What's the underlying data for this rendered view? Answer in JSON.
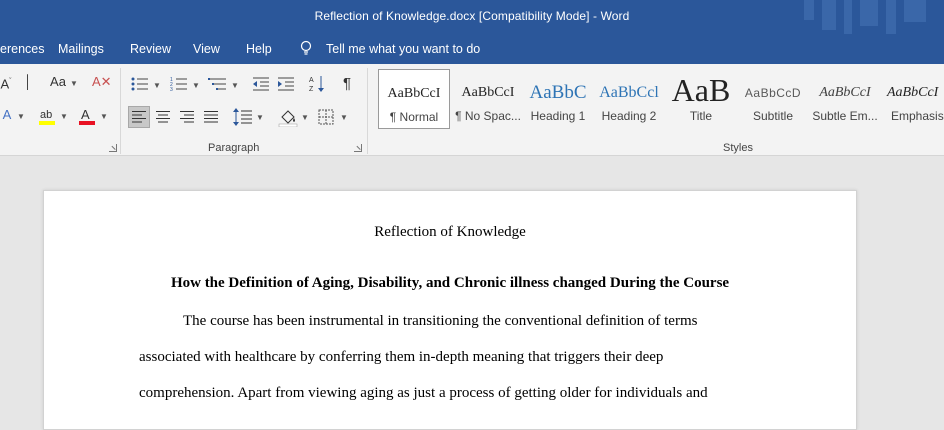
{
  "window": {
    "title": "Reflection of Knowledge.docx [Compatibility Mode]  -  Word"
  },
  "menu": {
    "items": [
      "erences",
      "Mailings",
      "Review",
      "View",
      "Help"
    ],
    "tell_me": "Tell me what you want to do"
  },
  "ribbon": {
    "paragraph_label": "Paragraph",
    "styles_label": "Styles",
    "font_case_label": "Aa",
    "styles": [
      {
        "preview": "AaBbCcI",
        "name": "¶ Normal"
      },
      {
        "preview": "AaBbCcI",
        "name": "¶ No Spac..."
      },
      {
        "preview": "AaBbC",
        "name": "Heading 1"
      },
      {
        "preview": "AaBbCcl",
        "name": "Heading 2"
      },
      {
        "preview": "AaB",
        "name": "Title"
      },
      {
        "preview": "AaBbCcD",
        "name": "Subtitle"
      },
      {
        "preview": "AaBbCcI",
        "name": "Subtle Em..."
      },
      {
        "preview": "AaBbCcI",
        "name": "Emphasis"
      }
    ],
    "colors": {
      "highlight": "#ffff00",
      "font_color": "#e81123",
      "accent": "#2b579a"
    }
  },
  "document": {
    "title": "Reflection of Knowledge",
    "heading": "How the Definition of Aging, Disability, and Chronic illness changed During the Course",
    "lines": [
      "The course has been instrumental in transitioning the conventional definition of terms",
      "associated with healthcare by conferring them in-depth meaning that triggers their deep",
      "comprehension. Apart from viewing aging as just a process of getting older for individuals and"
    ]
  }
}
